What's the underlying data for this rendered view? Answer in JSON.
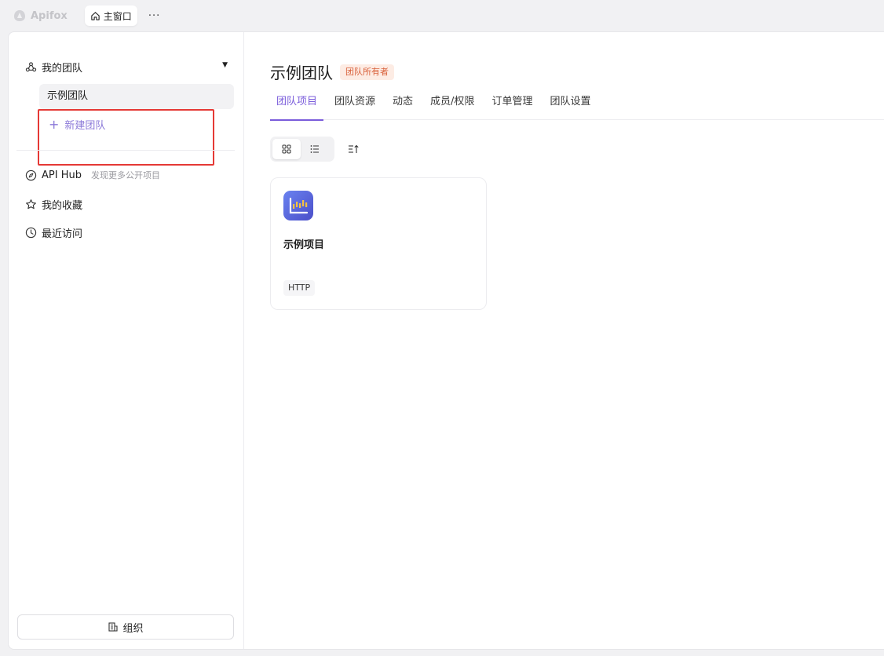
{
  "titlebar": {
    "app_name": "Apifox",
    "window_tab": "主窗口",
    "more": "···"
  },
  "sidebar": {
    "team_header": "我的团队",
    "team_item": "示例团队",
    "new_team": "新建团队",
    "api_hub": "API Hub",
    "api_hub_sub": "发现更多公开项目",
    "favorites": "我的收藏",
    "recent": "最近访问",
    "org_button": "组织"
  },
  "main": {
    "title": "示例团队",
    "owner_badge": "团队所有者",
    "tabs": [
      {
        "label": "团队项目",
        "active": true
      },
      {
        "label": "团队资源",
        "active": false
      },
      {
        "label": "动态",
        "active": false
      },
      {
        "label": "成员/权限",
        "active": false
      },
      {
        "label": "订单管理",
        "active": false
      },
      {
        "label": "团队设置",
        "active": false
      }
    ],
    "view_modes": [
      "grid-icon",
      "list-icon"
    ],
    "sort_icon": "sort-icon"
  },
  "projects": [
    {
      "name": "示例项目",
      "tag": "HTTP",
      "icon": "chart-project-icon"
    }
  ],
  "colors": {
    "accent": "#7a5cdb",
    "badge_bg": "#fdece4",
    "badge_text": "#d9613b",
    "highlight": "#e53935",
    "new_team_text": "#8c7ad9"
  }
}
